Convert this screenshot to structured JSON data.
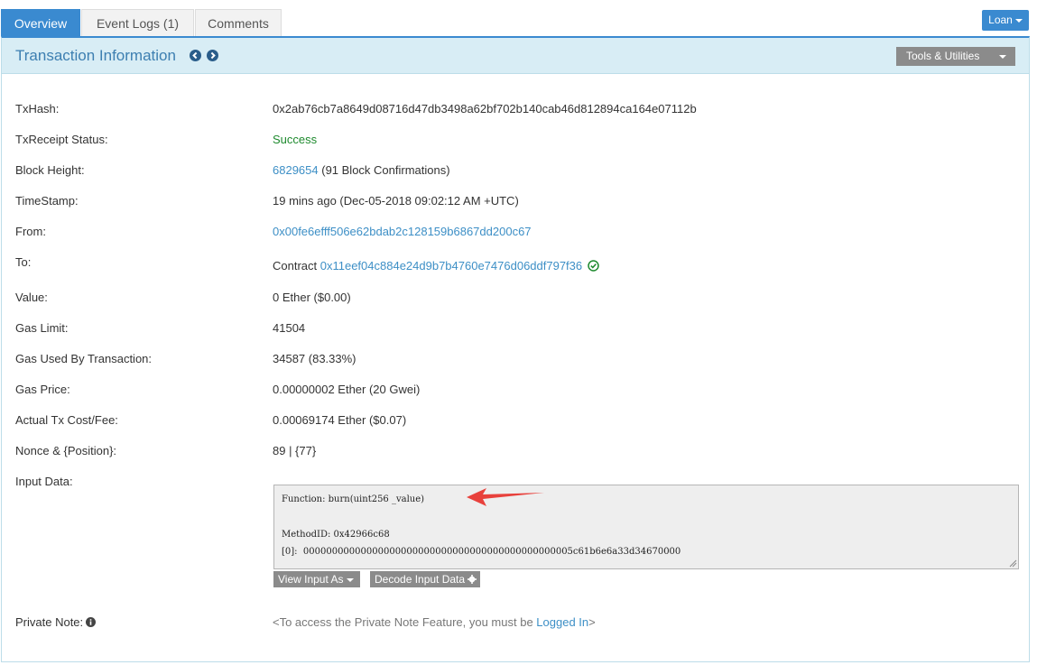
{
  "tabs": [
    {
      "label": "Overview",
      "active": true
    },
    {
      "label": "Event Logs (1)",
      "active": false
    },
    {
      "label": "Comments",
      "active": false
    }
  ],
  "loan_button": "Loan",
  "panel": {
    "title": "Transaction Information",
    "tools_label": "Tools & Utilities"
  },
  "rows": {
    "txhash": {
      "label": "TxHash:",
      "value": "0x2ab76cb7a8649d08716d47db3498a62bf702b140cab46d812894ca164e07112b"
    },
    "status": {
      "label": "TxReceipt Status:",
      "value": "Success"
    },
    "block": {
      "label": "Block Height:",
      "link": "6829654",
      "suffix": " (91 Block Confirmations)"
    },
    "timestamp": {
      "label": "TimeStamp:",
      "value": "19 mins ago (Dec-05-2018 09:02:12 AM +UTC)"
    },
    "from": {
      "label": "From:",
      "link": "0x00fe6efff506e62bdab2c128159b6867dd200c67"
    },
    "to": {
      "label": "To:",
      "prefix": "Contract ",
      "link": "0x11eef04c884e24d9b7b4760e7476d06ddf797f36"
    },
    "value": {
      "label": "Value:",
      "value": "0 Ether ($0.00)"
    },
    "gas_limit": {
      "label": "Gas Limit:",
      "value": "41504"
    },
    "gas_used": {
      "label": "Gas Used By Transaction:",
      "value": "34587 (83.33%)"
    },
    "gas_price": {
      "label": "Gas Price:",
      "value": "0.00000002 Ether (20 Gwei)"
    },
    "fee": {
      "label": "Actual Tx Cost/Fee:",
      "value": "0.00069174 Ether ($0.07)"
    },
    "nonce": {
      "label": "Nonce & {Position}:",
      "value": "89 | {77}"
    },
    "input": {
      "label": "Input Data:"
    },
    "private_note": {
      "label": "Private Note:",
      "prefix": "<To access the Private Note Feature, you must be ",
      "link": "Logged In",
      "suffix": ">"
    }
  },
  "input_data": {
    "function": "Function: burn(uint256 _value)",
    "method_id": "MethodID: 0x42966c68",
    "param0": "[0]:  00000000000000000000000000000000000000000000005c61b6e6a33d34670000"
  },
  "buttons": {
    "view_input": "View Input As",
    "decode_input": "Decode Input Data"
  },
  "colors": {
    "accent": "#3a8ad0",
    "header_bg": "#d8edf5",
    "link": "#3d8fc6",
    "success": "#1e8a2e",
    "arrow": "#e8413c"
  }
}
